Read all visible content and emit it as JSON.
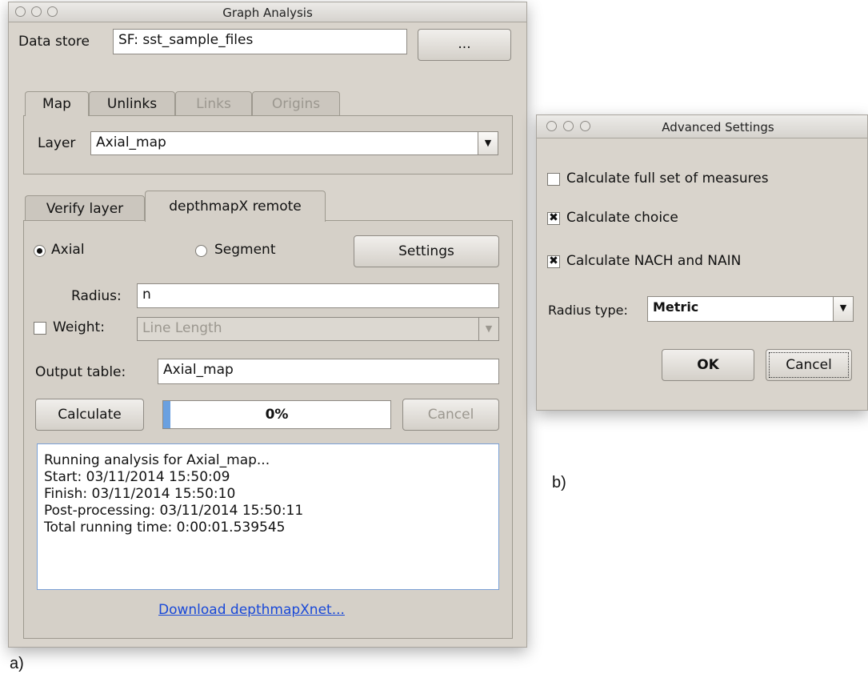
{
  "graph_window": {
    "title": "Graph Analysis",
    "data_store_label": "Data store",
    "data_store_value": "SF: sst_sample_files",
    "browse_button": "...",
    "tabs": [
      {
        "label": "Map",
        "active": true
      },
      {
        "label": "Unlinks",
        "active": false
      },
      {
        "label": "Links",
        "disabled": true
      },
      {
        "label": "Origins",
        "disabled": true
      }
    ],
    "layer_label": "Layer",
    "layer_value": "Axial_map",
    "lower_tabs": [
      {
        "label": "Verify layer",
        "active": false
      },
      {
        "label": "depthmapX remote",
        "active": true
      }
    ],
    "radio_axial": "Axial",
    "radio_segment": "Segment",
    "settings_button": "Settings",
    "radius_label": "Radius:",
    "radius_value": "n",
    "weight_label": "Weight:",
    "weight_value": "Line Length",
    "output_label": "Output table:",
    "output_value": "Axial_map",
    "calculate_button": "Calculate",
    "progress_text": "0%",
    "progress_value": 0,
    "cancel_button": "Cancel",
    "log_lines": [
      "Running analysis for Axial_map...",
      "Start: 03/11/2014 15:50:09",
      "Finish: 03/11/2014 15:50:10",
      "Post-processing: 03/11/2014 15:50:11",
      "Total running time: 0:00:01.539545"
    ],
    "download_link": "Download depthmapXnet..."
  },
  "advanced_window": {
    "title": "Advanced Settings",
    "check_full": "Calculate full set of measures",
    "check_full_checked": false,
    "check_choice": "Calculate choice",
    "check_choice_checked": true,
    "check_nach": "Calculate NACH and NAIN",
    "check_nach_checked": true,
    "radius_type_label": "Radius type:",
    "radius_type_value": "Metric",
    "ok_button": "OK",
    "cancel_button": "Cancel"
  },
  "caption_a": "a)",
  "caption_b": "b)"
}
